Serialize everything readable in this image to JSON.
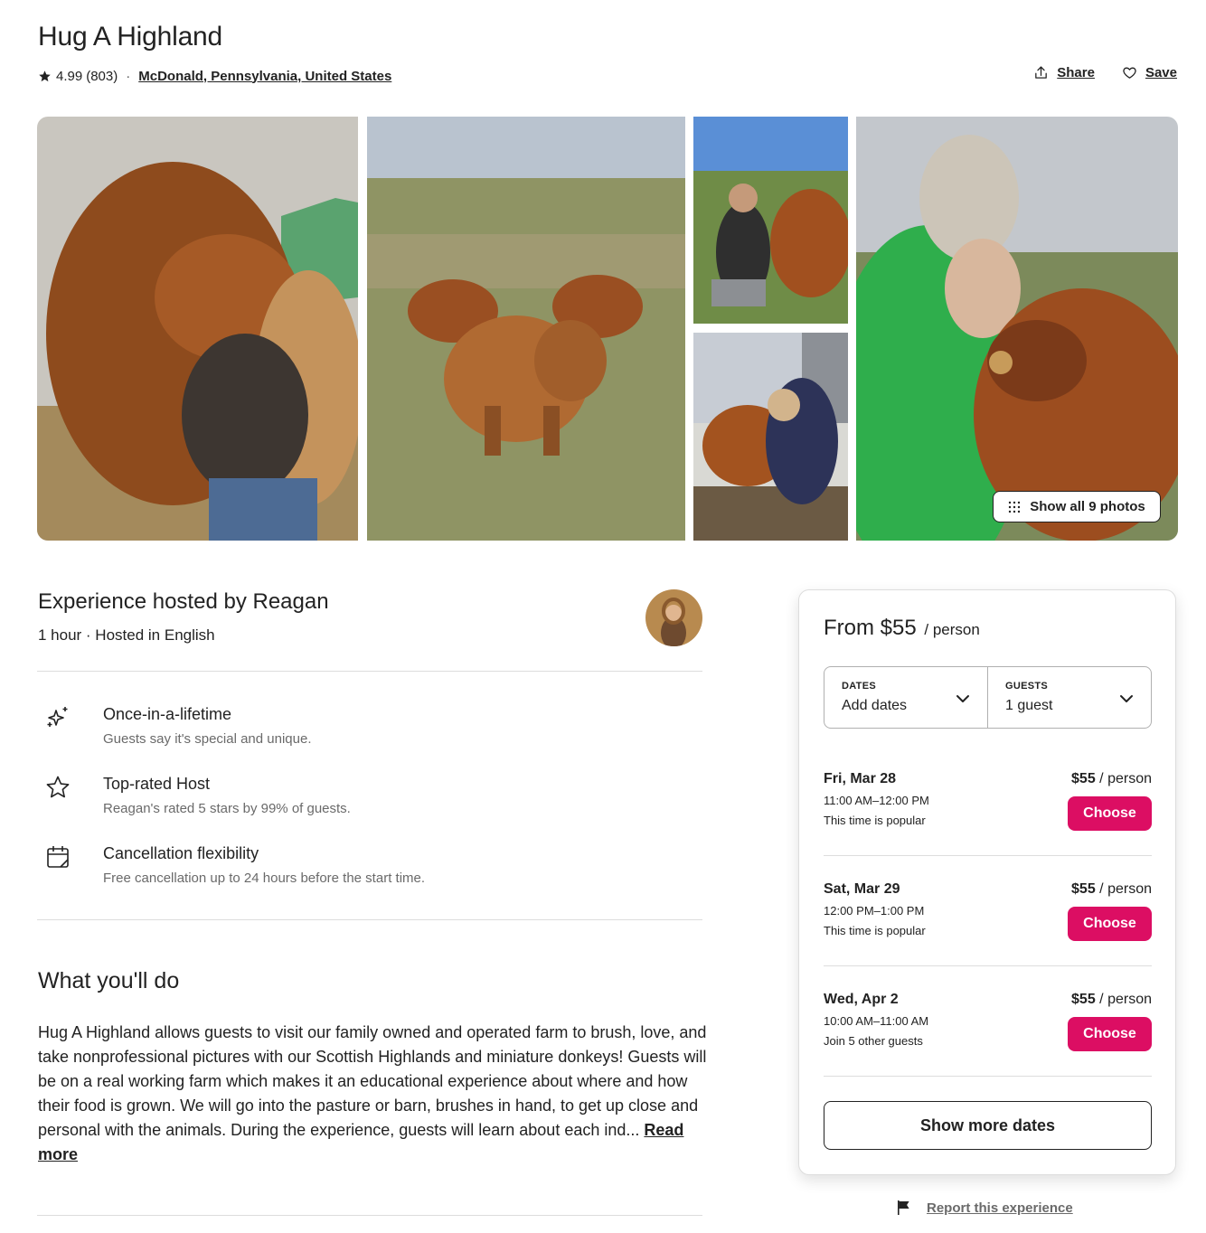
{
  "listing": {
    "title": "Hug A Highland",
    "rating": "4.99",
    "reviews": "(803)",
    "separator": "·",
    "location": "McDonald, Pennsylvania, United States"
  },
  "actions": {
    "share": "Share",
    "save": "Save"
  },
  "gallery": {
    "show_all": "Show all 9 photos"
  },
  "host": {
    "title": "Experience hosted by Reagan",
    "meta": "1 hour · Hosted in English"
  },
  "features": [
    {
      "icon": "sparkles-icon",
      "title": "Once-in-a-lifetime",
      "desc": "Guests say it's special and unique."
    },
    {
      "icon": "star-outline-icon",
      "title": "Top-rated Host",
      "desc": "Reagan's rated 5 stars by 99% of guests."
    },
    {
      "icon": "calendar-icon",
      "title": "Cancellation flexibility",
      "desc": "Free cancellation up to 24 hours before the start time."
    }
  ],
  "about": {
    "title": "What you'll do",
    "text": "Hug A Highland allows guests to visit our family owned and operated farm to brush, love, and take nonprofessional pictures with our Scottish Highlands and miniature donkeys! Guests will be on a real working farm which makes it an educational experience about where and how their food is grown. We will go into the pasture or barn, brushes in hand, to get up close and personal with the animals. During the experience, guests will learn about each ind...",
    "read_more": "Read more"
  },
  "booking": {
    "price_from": "From $55",
    "per": "/ person",
    "dates_label": "DATES",
    "dates_value": "Add dates",
    "guests_label": "GUESTS",
    "guests_value": "1 guest",
    "slots": [
      {
        "date": "Fri, Mar 28",
        "time": "11:00 AM–12:00 PM",
        "note": "This time is popular",
        "price": "$55",
        "per": " / person",
        "button": "Choose"
      },
      {
        "date": "Sat, Mar 29",
        "time": "12:00 PM–1:00 PM",
        "note": "This time is popular",
        "price": "$55",
        "per": " / person",
        "button": "Choose"
      },
      {
        "date": "Wed, Apr 2",
        "time": "10:00 AM–11:00 AM",
        "note": "Join 5 other guests",
        "price": "$55",
        "per": " / person",
        "button": "Choose"
      }
    ],
    "show_more": "Show more dates"
  },
  "report": {
    "label": "Report this experience"
  },
  "colors": {
    "brand": "#dc0e63",
    "text": "#222222",
    "muted": "#6a6a6a",
    "border": "#dddddd"
  }
}
